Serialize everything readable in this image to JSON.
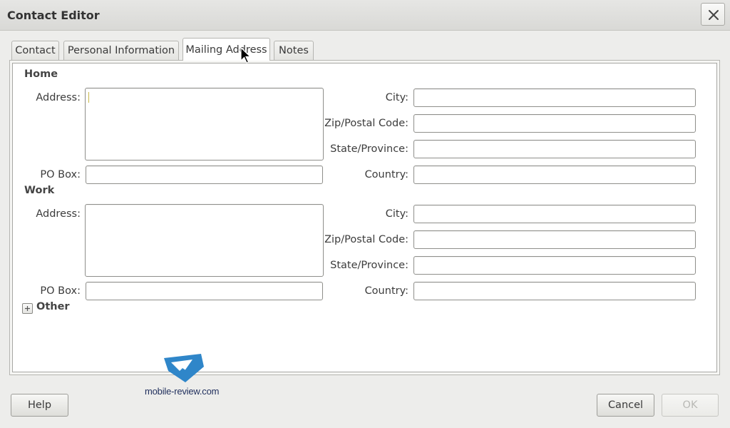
{
  "window": {
    "title": "Contact Editor"
  },
  "tabs": [
    {
      "label": "Contact",
      "active": false
    },
    {
      "label": "Personal Information",
      "active": false
    },
    {
      "label": "Mailing Address",
      "active": true
    },
    {
      "label": "Notes",
      "active": false
    }
  ],
  "home": {
    "heading": "Home",
    "address_label": "Address:",
    "address_value": "",
    "po_box_label": "PO Box:",
    "po_box_value": "",
    "city_label": "City:",
    "city_value": "",
    "zip_label": "Zip/Postal Code:",
    "zip_value": "",
    "state_label": "State/Province:",
    "state_value": "",
    "country_label": "Country:",
    "country_value": ""
  },
  "work": {
    "heading": "Work",
    "address_label": "Address:",
    "address_value": "",
    "po_box_label": "PO Box:",
    "po_box_value": "",
    "city_label": "City:",
    "city_value": "",
    "zip_label": "Zip/Postal Code:",
    "zip_value": "",
    "state_label": "State/Province:",
    "state_value": "",
    "country_label": "Country:",
    "country_value": ""
  },
  "other": {
    "heading": "Other",
    "expanded": false
  },
  "buttons": {
    "help": "Help",
    "cancel": "Cancel",
    "ok": "OK"
  },
  "watermark": {
    "text": "mobile-review.com"
  },
  "icons": {
    "close": "close-icon",
    "expander": "plus-icon",
    "cursor": "mouse-pointer-icon"
  },
  "colors": {
    "accent_caret": "#c9b94a",
    "watermark_blue": "#2f86c9"
  }
}
